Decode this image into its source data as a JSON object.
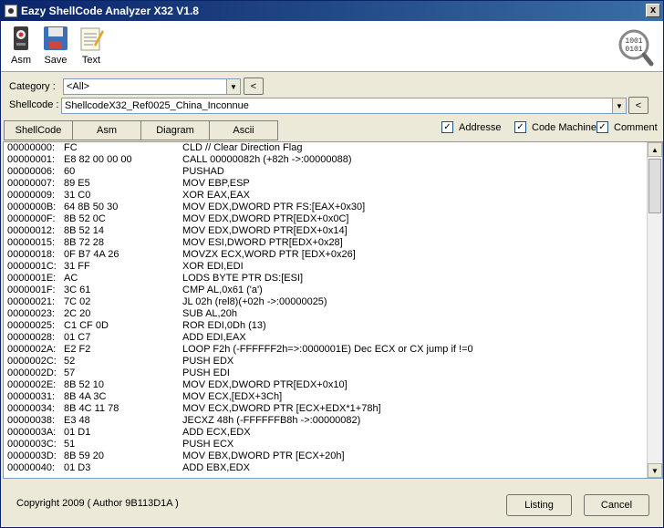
{
  "window": {
    "title": "Eazy ShellCode Analyzer X32 V1.8",
    "close_label": "x"
  },
  "toolbar": {
    "asm_label": "Asm",
    "save_label": "Save",
    "text_label": "Text",
    "logo_text": "1001 0101"
  },
  "filters": {
    "category_label": "Category :",
    "category_value": "<All>",
    "shellcode_label": "Shellcode :",
    "shellcode_value": "ShellcodeX32_Ref0025_China_Inconnue",
    "back_label": "<"
  },
  "tabs": [
    "ShellCode",
    "Asm",
    "Diagram",
    "Ascii"
  ],
  "options": [
    {
      "label": "Addresse",
      "checked": true
    },
    {
      "label": "Code Machine",
      "checked": true
    },
    {
      "label": "Comment",
      "checked": true
    }
  ],
  "listing": [
    [
      "00000000:",
      "FC",
      "CLD           // Clear Direction Flag"
    ],
    [
      "00000001:",
      "E8 82 00 00 00",
      "CALL 00000082h (+82h ->:00000088)"
    ],
    [
      "00000006:",
      "60",
      "PUSHAD"
    ],
    [
      "00000007:",
      "89 E5",
      "MOV EBP,ESP"
    ],
    [
      "00000009:",
      "31 C0",
      "XOR EAX,EAX"
    ],
    [
      "0000000B:",
      "64 8B 50 30",
      "MOV EDX,DWORD PTR FS:[EAX+0x30]"
    ],
    [
      "0000000F:",
      "8B 52 0C",
      "MOV EDX,DWORD PTR[EDX+0x0C]"
    ],
    [
      "00000012:",
      "8B 52 14",
      "MOV EDX,DWORD PTR[EDX+0x14]"
    ],
    [
      "00000015:",
      "8B 72 28",
      "MOV ESI,DWORD PTR[EDX+0x28]"
    ],
    [
      "00000018:",
      "0F B7 4A 26",
      "MOVZX ECX,WORD PTR [EDX+0x26]"
    ],
    [
      "0000001C:",
      "31 FF",
      "XOR EDI,EDI"
    ],
    [
      "0000001E:",
      "AC",
      "LODS BYTE PTR DS:[ESI]"
    ],
    [
      "0000001F:",
      "3C 61",
      "CMP AL,0x61 ('a')"
    ],
    [
      "00000021:",
      "7C 02",
      "JL 02h (rel8)(+02h ->:00000025)"
    ],
    [
      "00000023:",
      "2C 20",
      "SUB AL,20h"
    ],
    [
      "00000025:",
      "C1 CF 0D",
      "ROR EDI,0Dh (13)"
    ],
    [
      "00000028:",
      "01 C7",
      "ADD EDI,EAX"
    ],
    [
      "0000002A:",
      "E2 F2",
      "LOOP F2h (-FFFFFF2h=>:0000001E) Dec ECX or CX jump if !=0"
    ],
    [
      "0000002C:",
      "52",
      "PUSH EDX"
    ],
    [
      "0000002D:",
      "57",
      "PUSH EDI"
    ],
    [
      "0000002E:",
      "8B 52 10",
      "MOV EDX,DWORD PTR[EDX+0x10]"
    ],
    [
      "00000031:",
      "8B 4A 3C",
      "MOV ECX,[EDX+3Ch]"
    ],
    [
      "00000034:",
      "8B 4C 11 78",
      "MOV ECX,DWORD PTR [ECX+EDX*1+78h]"
    ],
    [
      "00000038:",
      "E3 48",
      "JECXZ 48h (-FFFFFFB8h ->:00000082)"
    ],
    [
      "0000003A:",
      "01 D1",
      "ADD ECX,EDX"
    ],
    [
      "0000003C:",
      "51",
      "PUSH ECX"
    ],
    [
      "0000003D:",
      "8B 59 20",
      "MOV EBX,DWORD PTR [ECX+20h]"
    ],
    [
      "00000040:",
      "01 D3",
      "ADD EBX,EDX"
    ]
  ],
  "footer": {
    "copyright": "Copyright 2009 ( Author 9B113D1A )",
    "listing_label": "Listing",
    "cancel_label": "Cancel"
  }
}
